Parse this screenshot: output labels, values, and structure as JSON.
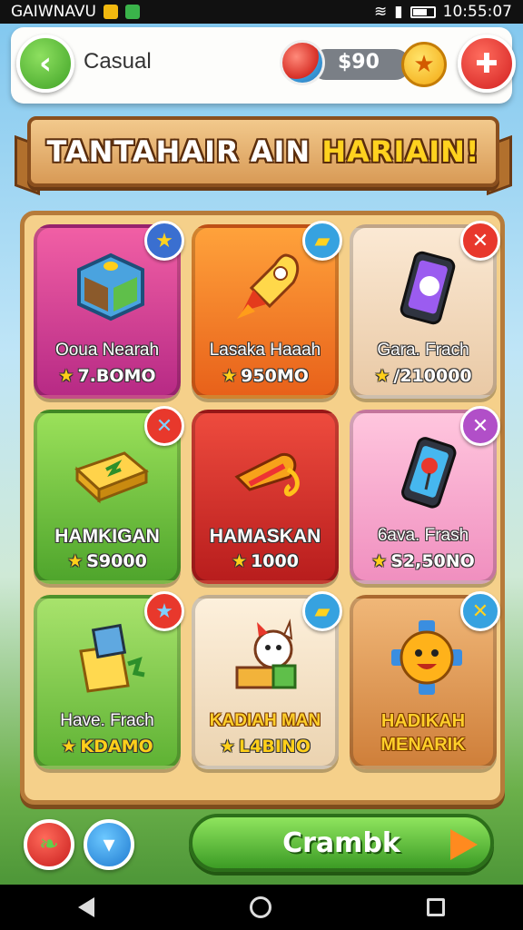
{
  "status_bar": {
    "carrier": "GAIWNAVU",
    "time": "10:55:07"
  },
  "top_bar": {
    "back_icon": "chevron-left-icon",
    "mode": "Casual",
    "coins": "$90",
    "menu_icon": "puzzle-icon"
  },
  "banner": {
    "title_main": "TANTAHAIR AIN ",
    "title_highlight": "HARIAIN!"
  },
  "cards": [
    {
      "name": "Ooua Nearah",
      "price": "7.BOMO",
      "icon": "cube-icon",
      "badge": "star",
      "color": "magenta"
    },
    {
      "name": "Lasaka Haaah",
      "price": "950MO",
      "icon": "rocket-icon",
      "badge": "ticket",
      "color": "orange"
    },
    {
      "name": "Gara. Frach",
      "price": "/210000",
      "icon": "phone-icon",
      "badge": "close",
      "color": "cream"
    },
    {
      "name": "HAMKIGAN",
      "price": "S9000",
      "icon": "chest-icon",
      "badge": "close",
      "color": "green"
    },
    {
      "name": "HAMASKAN",
      "price": "1000",
      "icon": "candy-icon",
      "badge": "none",
      "color": "red"
    },
    {
      "name": "6ava. Frash",
      "price": "S2,50NO",
      "icon": "phone-icon",
      "badge": "close",
      "color": "pink"
    },
    {
      "name": "Have. Frach",
      "price": "KDAMO",
      "icon": "box-icon",
      "badge": "star",
      "color": "lgreen"
    },
    {
      "name": "KADIAH MAN",
      "price": "L4BINO",
      "icon": "cat-icon",
      "badge": "ticket",
      "color": "sand"
    },
    {
      "name": "HADIKAH MENARIK",
      "price": "",
      "icon": "sun-icon",
      "badge": "close",
      "color": "tan"
    }
  ],
  "bottom": {
    "play_label": "Crambk"
  }
}
